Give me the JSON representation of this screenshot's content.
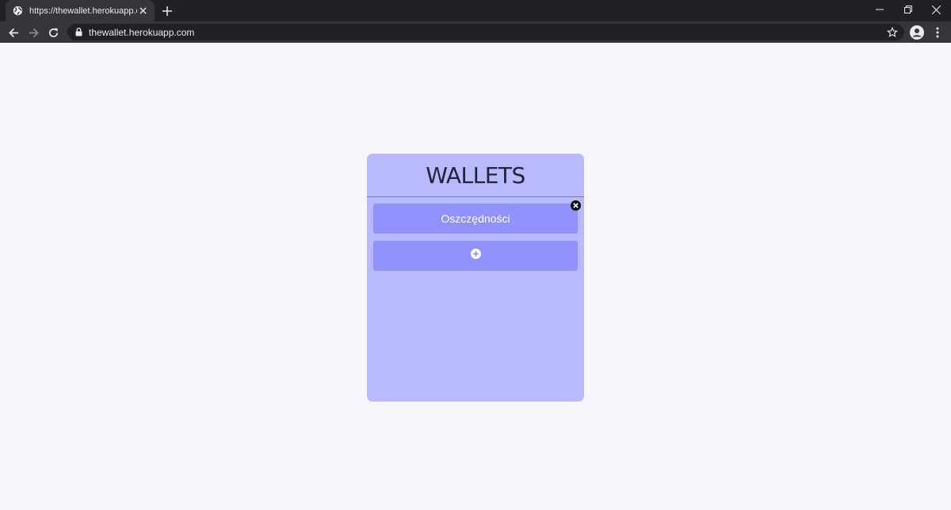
{
  "browser": {
    "tab": {
      "title": "https://thewallet.herokuapp.com"
    },
    "address_bar": {
      "url": "thewallet.herokuapp.com"
    }
  },
  "page": {
    "card_title": "WALLETS",
    "wallets": [
      {
        "name": "Oszczędności"
      }
    ]
  },
  "colors": {
    "page_background": "#f7f6fd",
    "card_background": "#b9b9fd",
    "wallet_button": "#9191fc",
    "title_text": "#25233a"
  }
}
